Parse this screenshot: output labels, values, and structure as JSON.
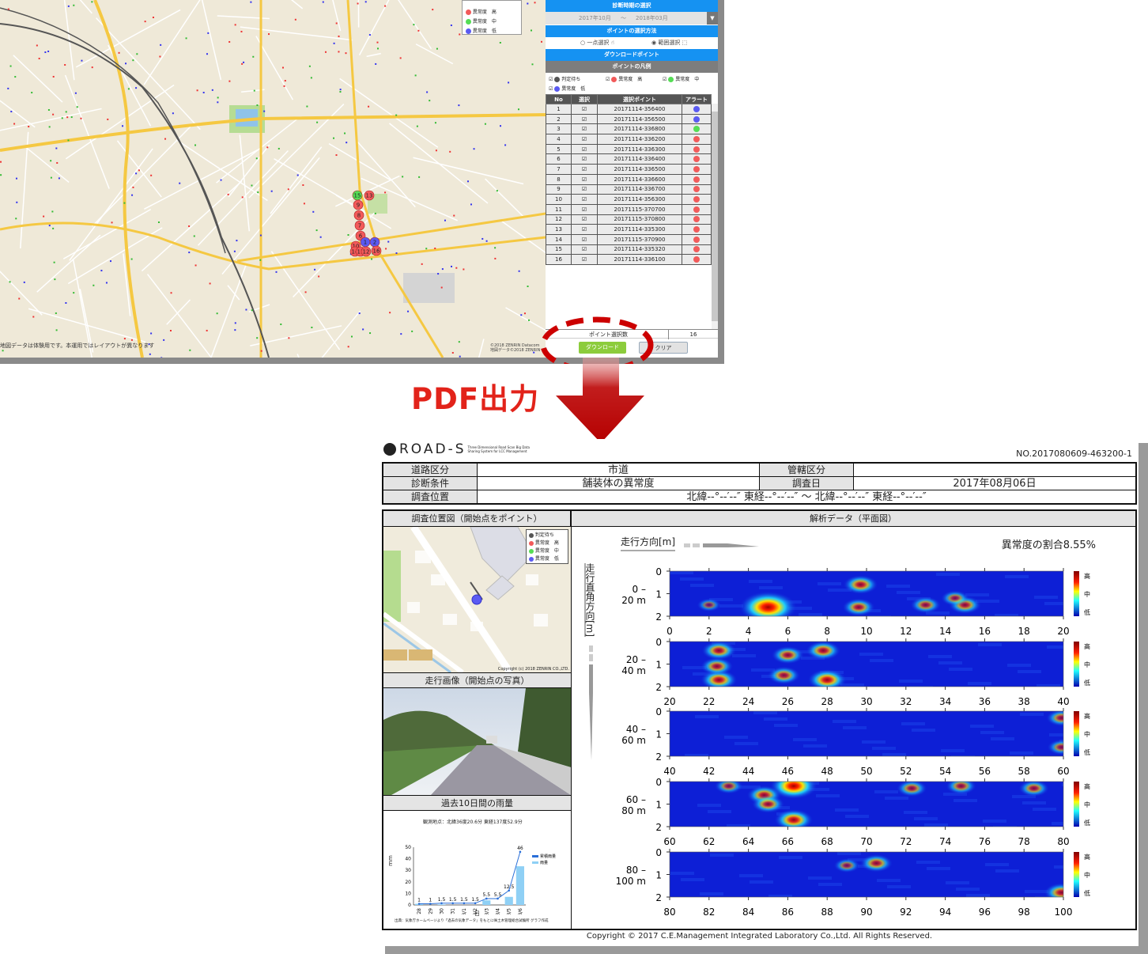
{
  "app": {
    "period": {
      "header": "診断時期の選択",
      "from": "2017年10月",
      "sep": "～",
      "to": "2018年03月"
    },
    "method": {
      "header": "ポイントの選択方法",
      "single": "一点選択",
      "range": "範囲選択"
    },
    "download_header": "ダウンロードポイント",
    "legend": {
      "header": "ポイントの凡例",
      "items": [
        {
          "label": "判定待ち",
          "color": "#555555"
        },
        {
          "label": "異常度　高",
          "color": "#f25a5a"
        },
        {
          "label": "異常度　中",
          "color": "#55dd55"
        },
        {
          "label": "異常度　低",
          "color": "#5a5af2"
        }
      ]
    },
    "table": {
      "headers": [
        "No",
        "選択",
        "選択ポイント",
        "アラート"
      ],
      "rows": [
        [
          "1",
          "20171114-356400",
          "#5a5af2"
        ],
        [
          "2",
          "20171114-356500",
          "#5a5af2"
        ],
        [
          "3",
          "20171114-336800",
          "#55dd55"
        ],
        [
          "4",
          "20171114-336200",
          "#f25a5a"
        ],
        [
          "5",
          "20171114-336300",
          "#f25a5a"
        ],
        [
          "6",
          "20171114-336400",
          "#f25a5a"
        ],
        [
          "7",
          "20171114-336500",
          "#f25a5a"
        ],
        [
          "8",
          "20171114-336600",
          "#f25a5a"
        ],
        [
          "9",
          "20171114-336700",
          "#f25a5a"
        ],
        [
          "10",
          "20171114-356300",
          "#f25a5a"
        ],
        [
          "11",
          "20171115-370700",
          "#f25a5a"
        ],
        [
          "12",
          "20171115-370800",
          "#f25a5a"
        ],
        [
          "13",
          "20171114-335300",
          "#f25a5a"
        ],
        [
          "14",
          "20171115-370900",
          "#f25a5a"
        ],
        [
          "15",
          "20171114-335320",
          "#f25a5a"
        ],
        [
          "16",
          "20171114-336100",
          "#f25a5a"
        ]
      ]
    },
    "count_label": "ポイント選択数",
    "count": "16",
    "download_btn": "ダウンロード",
    "clear_btn": "クリア",
    "map": {
      "notice": "地図データは体験用です。本運用ではレイアウトが異なります",
      "copyright1": "©2018 ZENRIN Datacom",
      "copyright2": "地図データ©2018 ZENRIN",
      "legend": [
        {
          "label": "異常度　高",
          "color": "#f25a5a"
        },
        {
          "label": "異常度　中",
          "color": "#55dd55"
        },
        {
          "label": "異常度　低",
          "color": "#5a5af2"
        }
      ],
      "markers": [
        {
          "n": "15",
          "c": "#55dd55"
        },
        {
          "n": "13",
          "c": "#f25a5a"
        },
        {
          "n": "9",
          "c": "#f25a5a"
        },
        {
          "n": "8",
          "c": "#f25a5a"
        },
        {
          "n": "7",
          "c": "#f25a5a"
        },
        {
          "n": "6",
          "c": "#f25a5a"
        },
        {
          "n": "1",
          "c": "#5a5af2"
        },
        {
          "n": "2",
          "c": "#5a5af2"
        },
        {
          "n": "10",
          "c": "#f25a5a"
        },
        {
          "n": "14",
          "c": "#f25a5a"
        },
        {
          "n": "11",
          "c": "#f25a5a"
        },
        {
          "n": "12",
          "c": "#f25a5a"
        },
        {
          "n": "16",
          "c": "#f25a5a"
        }
      ]
    }
  },
  "arrow_label": "PDF出力",
  "report": {
    "logo": "ROAD-S",
    "logo_sub1": "Three Dimensional Road Scan Big Data",
    "logo_sub2": "Sharing System for LCC Management",
    "number": "NO.2017080609-463200-1",
    "road_type_label": "道路区分",
    "road_type": "市道",
    "admin_label": "管轄区分",
    "admin": "",
    "condition_label": "診断条件",
    "condition": "舗装体の異常度",
    "date_label": "調査日",
    "date": "2017年08月06日",
    "location_label": "調査位置",
    "location": "北緯--°--′--″ 東経--°--′--″ ～ 北緯--°--′--″ 東経--°--′--″",
    "map_title": "調査位置図（開始点をポイント）",
    "map_legend": [
      {
        "label": "判定待ち",
        "color": "#555555"
      },
      {
        "label": "異常度　高",
        "color": "#f25a5a"
      },
      {
        "label": "異常度　中",
        "color": "#55dd55"
      },
      {
        "label": "異常度　低",
        "color": "#5a5af2"
      }
    ],
    "map_copyright": "Copyright (c) 2018 ZENRIN CO.,LTD.",
    "photo_title": "走行画像（開始点の写真）",
    "rain_title": "過去10日間の雨量",
    "analysis_title": "解析データ（平面図）",
    "direction_label": "走行方向[m]",
    "cross_label": "走行直角方向[m]",
    "ratio": "異常度の割合8.55%",
    "colorbar": [
      "高",
      "中",
      "低"
    ],
    "copyright": "Copyright © 2017 C.E.Management Integrated Laboratory Co.,Ltd. All Rights Reserved."
  },
  "chart_data": [
    {
      "type": "bar",
      "title": "観測地点：北緯36度20.6分 東経137度52.9分",
      "xlabel": "日",
      "ylabel": "mm",
      "ylim": [
        0,
        50
      ],
      "categories": [
        "7/28",
        "7/29",
        "7/30",
        "7/31",
        "8/1",
        "8/2",
        "8/3",
        "8/4",
        "8/5",
        "8/6"
      ],
      "series": [
        {
          "name": "累積雨量",
          "type": "line",
          "values": [
            1,
            1,
            1.5,
            1.5,
            1.5,
            1.5,
            5.5,
            5.5,
            12.5,
            46
          ]
        },
        {
          "name": "雨量",
          "type": "bar",
          "values": [
            1,
            0,
            0.5,
            0,
            0,
            0,
            4,
            0,
            7,
            33.5
          ]
        }
      ],
      "source": "出典：気象庁ホームページより「過去の気象データ」をもとに㈱土木管理総合試験所 グラフ作成"
    },
    {
      "type": "heatmap",
      "ylim": [
        0,
        2
      ],
      "panels": [
        {
          "range": "0 –\n20 m",
          "from": 0,
          "to": 20,
          "spots": [
            [
              5,
              1.6,
              1.0
            ],
            [
              9.7,
              0.6,
              0.45
            ],
            [
              9.6,
              1.6,
              0.4
            ],
            [
              13,
              1.5,
              0.35
            ],
            [
              15,
              1.5,
              0.4
            ],
            [
              14.5,
              1.2,
              0.3
            ],
            [
              2,
              1.5,
              0.2
            ]
          ]
        },
        {
          "range": "20 –\n40 m",
          "from": 20,
          "to": 40,
          "spots": [
            [
              22.5,
              0.4,
              0.45
            ],
            [
              22.5,
              1.7,
              0.5
            ],
            [
              22.4,
              1.1,
              0.4
            ],
            [
              26,
              0.6,
              0.4
            ],
            [
              25.8,
              1.5,
              0.4
            ],
            [
              28,
              1.7,
              0.55
            ],
            [
              27.8,
              0.4,
              0.45
            ]
          ]
        },
        {
          "range": "40 –\n60 m",
          "from": 40,
          "to": 60,
          "spots": [
            [
              59.9,
              0.3,
              0.35
            ],
            [
              59.9,
              1.6,
              0.3
            ]
          ]
        },
        {
          "range": "60 –\n80 m",
          "from": 60,
          "to": 80,
          "spots": [
            [
              66.3,
              0.2,
              0.75
            ],
            [
              66.3,
              1.7,
              0.55
            ],
            [
              64.8,
              0.6,
              0.45
            ],
            [
              65,
              1,
              0.4
            ],
            [
              63,
              0.2,
              0.3
            ],
            [
              72.3,
              0.3,
              0.35
            ],
            [
              74.8,
              0.2,
              0.35
            ],
            [
              78.5,
              0.3,
              0.35
            ]
          ]
        },
        {
          "range": "80 –\n100 m",
          "from": 80,
          "to": 100,
          "spots": [
            [
              90.5,
              0.5,
              0.4
            ],
            [
              89,
              0.6,
              0.25
            ],
            [
              99.9,
              1.8,
              0.45
            ]
          ]
        }
      ]
    }
  ]
}
